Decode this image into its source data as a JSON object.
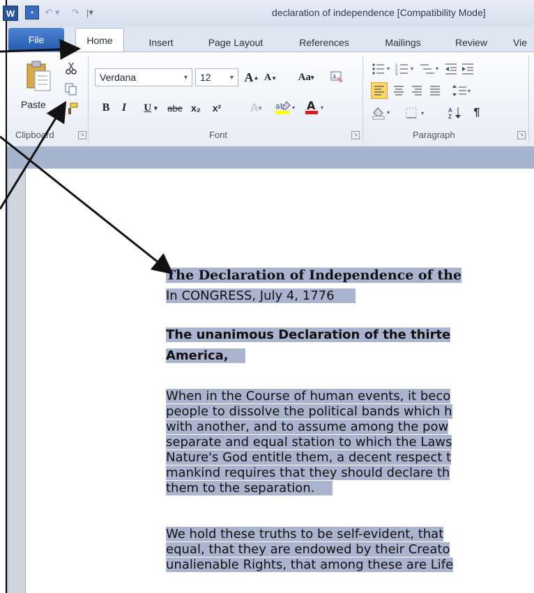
{
  "window": {
    "title": "declaration of independence [Compatibility Mode]",
    "qa_separator": "|"
  },
  "tabs": [
    {
      "label": "File"
    },
    {
      "label": "Home"
    },
    {
      "label": "Insert"
    },
    {
      "label": "Page Layout"
    },
    {
      "label": "References"
    },
    {
      "label": "Mailings"
    },
    {
      "label": "Review"
    },
    {
      "label": "Vie"
    }
  ],
  "ribbon": {
    "clipboard": {
      "paste_label": "Paste",
      "group_label": "Clipboard"
    },
    "font": {
      "font_name": "Verdana",
      "font_size": "12",
      "group_label": "Font",
      "bold": "B",
      "italic": "I",
      "underline": "U",
      "strike": "abe",
      "subscript": "x₂",
      "superscript": "x²",
      "grow": "A",
      "shrink": "A",
      "change_case": "Aa"
    },
    "paragraph": {
      "group_label": "Paragraph",
      "pilcrow": "¶"
    }
  },
  "document": {
    "heading": "The Declaration of Independence of the",
    "line_congress": "In CONGRESS, July 4, 1776",
    "subheading_1": "The unanimous Declaration of the thirte",
    "subheading_2": "America,",
    "para1": [
      "When in the Course of human events, it beco",
      "people to dissolve the political bands which h",
      "with another, and to assume among the pow",
      "separate and equal station to which the Laws",
      "Nature's God entitle them, a decent respect t",
      "mankind requires that they should declare th",
      "them to the separation."
    ],
    "para2": [
      "We hold these truths to be self-evident, that",
      "equal, that they are endowed by their Creato",
      "unalienable Rights, that among these are Life"
    ]
  }
}
